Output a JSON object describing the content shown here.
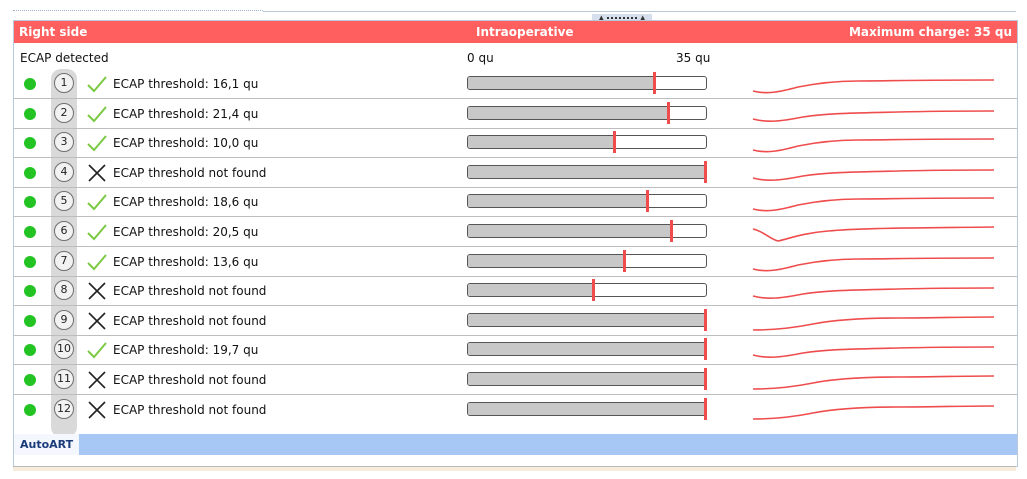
{
  "header": {
    "left": "Right side",
    "center": "Intraoperative",
    "right": "Maximum charge: 35 qu",
    "color": "#ff5f5f"
  },
  "subheader": {
    "label": "ECAP detected",
    "scale_min": "0 qu",
    "scale_max": "35 qu"
  },
  "scale": {
    "min": 0,
    "max": 35
  },
  "colors": {
    "ok_dot": "#22c322",
    "check": "#7ac943",
    "marker": "#ef4d4d",
    "footer": "#a7c8f5"
  },
  "rows": [
    {
      "electrode": "1",
      "status": "check-icon",
      "text": "ECAP threshold: 16,1 qu",
      "level": 27.5,
      "wave": "hump"
    },
    {
      "electrode": "2",
      "status": "check-icon",
      "text": "ECAP threshold: 21,4 qu",
      "level": 29.5,
      "wave": "flat"
    },
    {
      "electrode": "3",
      "status": "check-icon",
      "text": "ECAP threshold: 10,0 qu",
      "level": 21.5,
      "wave": "hump"
    },
    {
      "electrode": "4",
      "status": "cross-icon",
      "text": "ECAP threshold not found",
      "level": 35,
      "wave": "flat"
    },
    {
      "electrode": "5",
      "status": "check-icon",
      "text": "ECAP threshold: 18,6 qu",
      "level": 26.5,
      "wave": "hump"
    },
    {
      "electrode": "6",
      "status": "check-icon",
      "text": "ECAP threshold: 20,5 qu",
      "level": 30,
      "wave": "dip"
    },
    {
      "electrode": "7",
      "status": "check-icon",
      "text": "ECAP threshold: 13,6 qu",
      "level": 23,
      "wave": "hump"
    },
    {
      "electrode": "8",
      "status": "cross-icon",
      "text": "ECAP threshold not found",
      "level": 18.5,
      "wave": "flat"
    },
    {
      "electrode": "9",
      "status": "cross-icon",
      "text": "ECAP threshold not found",
      "level": 35,
      "wave": "rise"
    },
    {
      "electrode": "10",
      "status": "check-icon",
      "text": "ECAP threshold: 19,7 qu",
      "level": 35,
      "wave": "flat"
    },
    {
      "electrode": "11",
      "status": "cross-icon",
      "text": "ECAP threshold not found",
      "level": 35,
      "wave": "rise"
    },
    {
      "electrode": "12",
      "status": "cross-icon",
      "text": "ECAP threshold not found",
      "level": 35,
      "wave": "rise"
    }
  ],
  "footer": {
    "tab": "AutoART"
  }
}
